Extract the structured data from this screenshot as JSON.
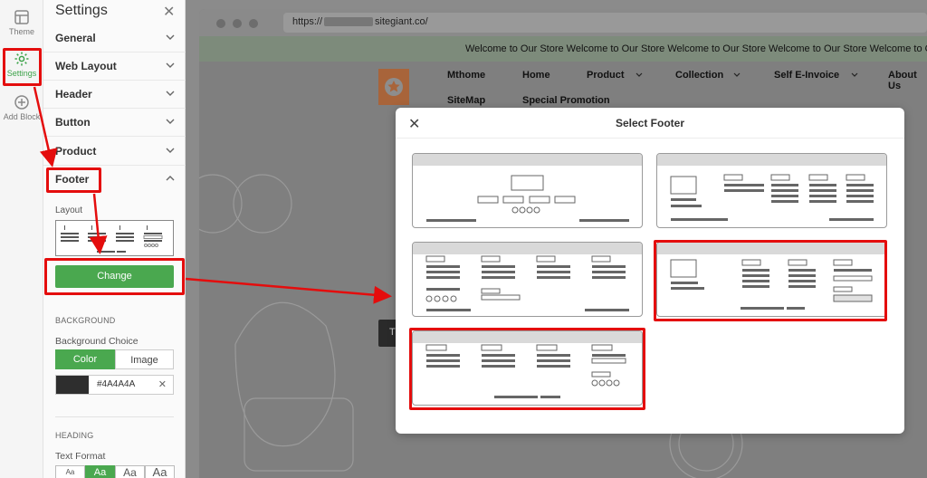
{
  "rail": [
    {
      "label": "Theme",
      "icon": "layout-icon"
    },
    {
      "label": "Settings",
      "icon": "gear-icon"
    },
    {
      "label": "Add Block",
      "icon": "plus-circle-icon"
    }
  ],
  "panel": {
    "title": "Settings",
    "sections": [
      "General",
      "Web Layout",
      "Header",
      "Button",
      "Product",
      "Footer"
    ],
    "layout_label": "Layout",
    "change_label": "Change",
    "background_heading": "BACKGROUND",
    "background_choice_label": "Background Choice",
    "color_label": "Color",
    "image_label": "Image",
    "color_value": "#4A4A4A",
    "heading_heading": "HEADING",
    "text_format_label": "Text Format",
    "text_format_options": [
      "Aa",
      "Aa",
      "Aa",
      "Aa"
    ]
  },
  "browser": {
    "url_prefix": "https://",
    "url_suffix": "sitegiant.co/",
    "marquee": "Welcome to Our Store Welcome to Our Store Welcome to Our Store Welcome to Our Store Welcome to Our S",
    "nav": [
      "Mthome",
      "Home",
      "Product",
      "Collection",
      "Self E-Invoice",
      "About Us",
      "SiteMap",
      "Special Promotion"
    ],
    "hero_button_text": "T"
  },
  "modal": {
    "title": "Select Footer",
    "options_count": 5
  },
  "colors": {
    "accent": "#4aa84f",
    "annotation": "#e40d0d",
    "swatch": "#4A4A4A"
  }
}
